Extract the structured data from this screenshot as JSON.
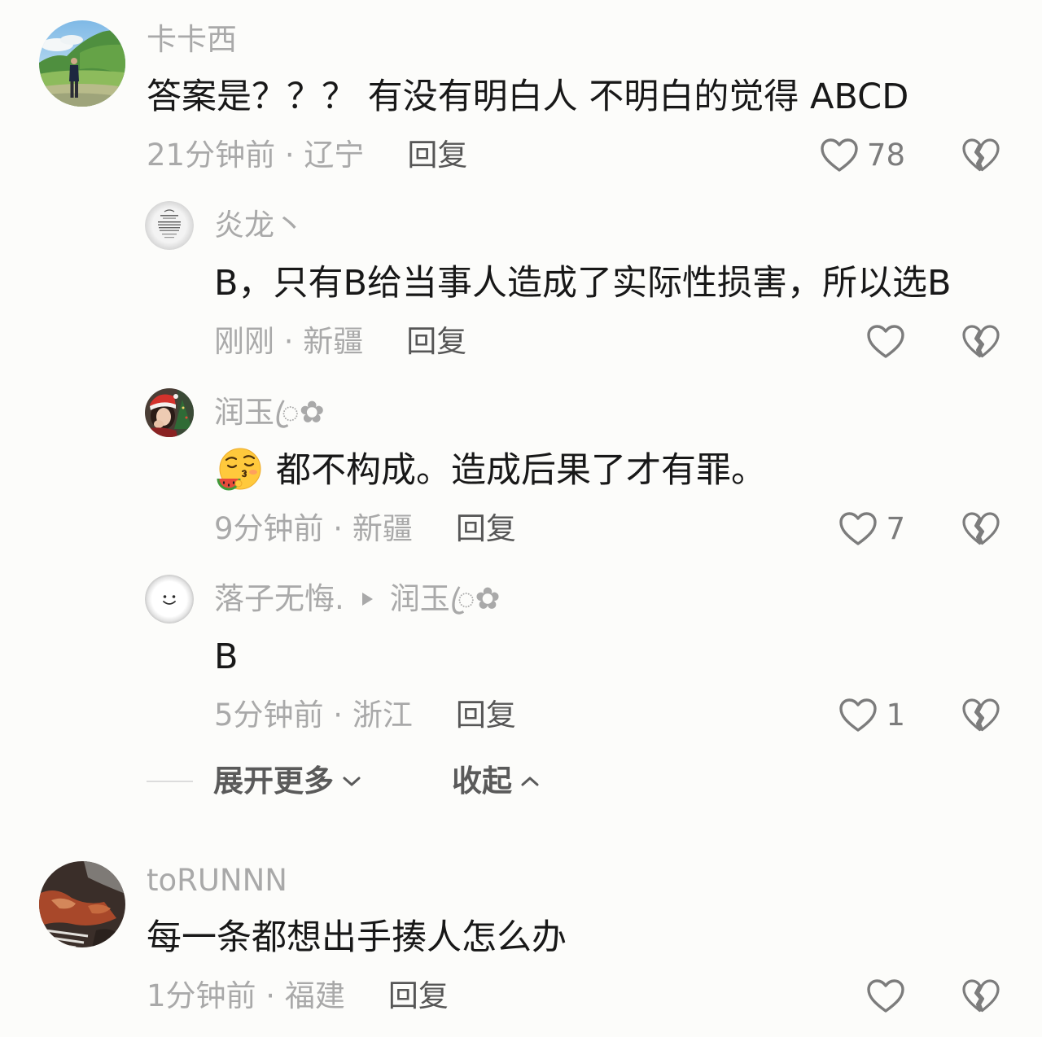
{
  "colors": {
    "background": "#fcfcfa",
    "text": "#181818",
    "muted": "#a9a9a9",
    "action": "#565656",
    "icon": "#7c7c7c",
    "divider": "#dcdcdc",
    "emphasis": "#5a5a5a"
  },
  "icons": {
    "like": "heart-icon",
    "dislike": "broken-heart-icon",
    "reply_to": "reply-to-arrow-icon",
    "expand": "chevron-down-icon",
    "collapse": "chevron-up-icon",
    "sticker": "eating-melon-emoji"
  },
  "comments": [
    {
      "username": "卡卡西",
      "content": "答案是？？？ 有没有明白人 不明白的觉得 ABCD",
      "meta": "21分钟前 · 辽宁",
      "reply_label": "回复",
      "likes": "78",
      "replies": [
        {
          "username": "炎龙丶",
          "content": "B，只有B给当事人造成了实际性损害，所以选B",
          "meta": "刚刚 · 新疆",
          "reply_label": "回复"
        },
        {
          "username": "润玉ꦿ✿",
          "content": "都不构成。造成后果了才有罪。",
          "meta": "9分钟前 · 新疆",
          "reply_label": "回复",
          "likes": "7"
        },
        {
          "username": "落子无悔.",
          "reply_to": "润玉ꦿ✿",
          "content": "B",
          "meta": "5分钟前 · 浙江",
          "reply_label": "回复",
          "likes": "1"
        }
      ],
      "expand_label": "展开更多",
      "collapse_label": "收起"
    },
    {
      "username": "toRUNNN",
      "content": "每一条都想出手揍人怎么办",
      "meta": "1分钟前 · 福建",
      "reply_label": "回复"
    }
  ]
}
